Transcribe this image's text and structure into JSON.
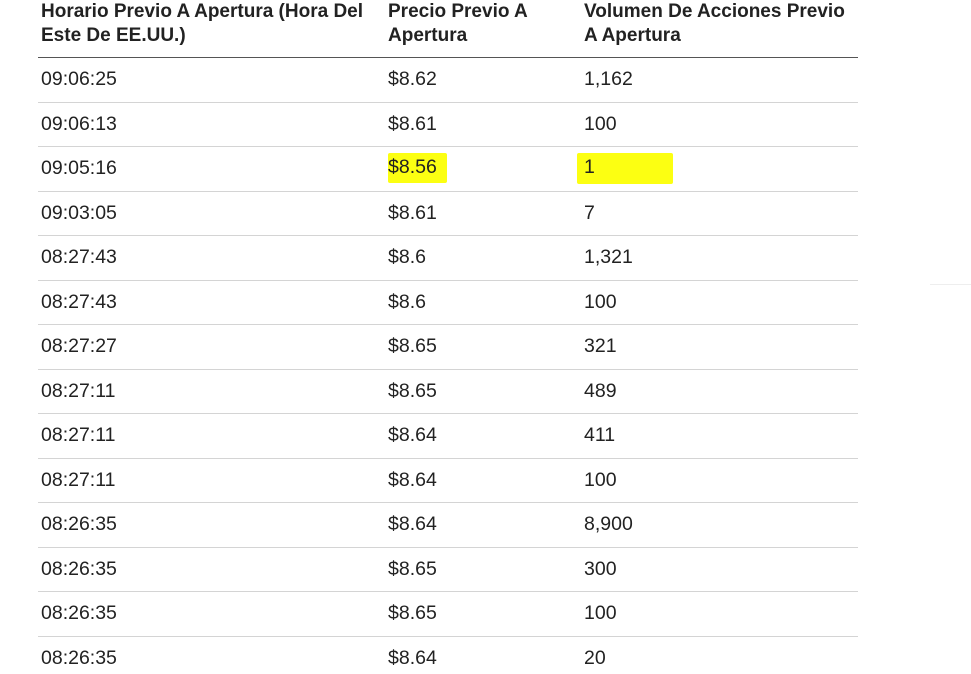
{
  "table": {
    "headers": [
      "Horario Previo A Apertura (Hora Del Este De EE.UU.)",
      "Precio Previo A Apertura",
      "Volumen De Acciones Previo A Apertura"
    ],
    "highlight_color": "#fcff12",
    "highlighted_row_index": 2,
    "rows": [
      {
        "time": "09:06:25",
        "price": "$8.62",
        "volume": "1,162"
      },
      {
        "time": "09:06:13",
        "price": "$8.61",
        "volume": "100"
      },
      {
        "time": "09:05:16",
        "price": "$8.56",
        "volume": "1"
      },
      {
        "time": "09:03:05",
        "price": "$8.61",
        "volume": "7"
      },
      {
        "time": "08:27:43",
        "price": "$8.6",
        "volume": "1,321"
      },
      {
        "time": "08:27:43",
        "price": "$8.6",
        "volume": "100"
      },
      {
        "time": "08:27:27",
        "price": "$8.65",
        "volume": "321"
      },
      {
        "time": "08:27:11",
        "price": "$8.65",
        "volume": "489"
      },
      {
        "time": "08:27:11",
        "price": "$8.64",
        "volume": "411"
      },
      {
        "time": "08:27:11",
        "price": "$8.64",
        "volume": "100"
      },
      {
        "time": "08:26:35",
        "price": "$8.64",
        "volume": "8,900"
      },
      {
        "time": "08:26:35",
        "price": "$8.65",
        "volume": "300"
      },
      {
        "time": "08:26:35",
        "price": "$8.65",
        "volume": "100"
      },
      {
        "time": "08:26:35",
        "price": "$8.64",
        "volume": "20"
      }
    ]
  }
}
